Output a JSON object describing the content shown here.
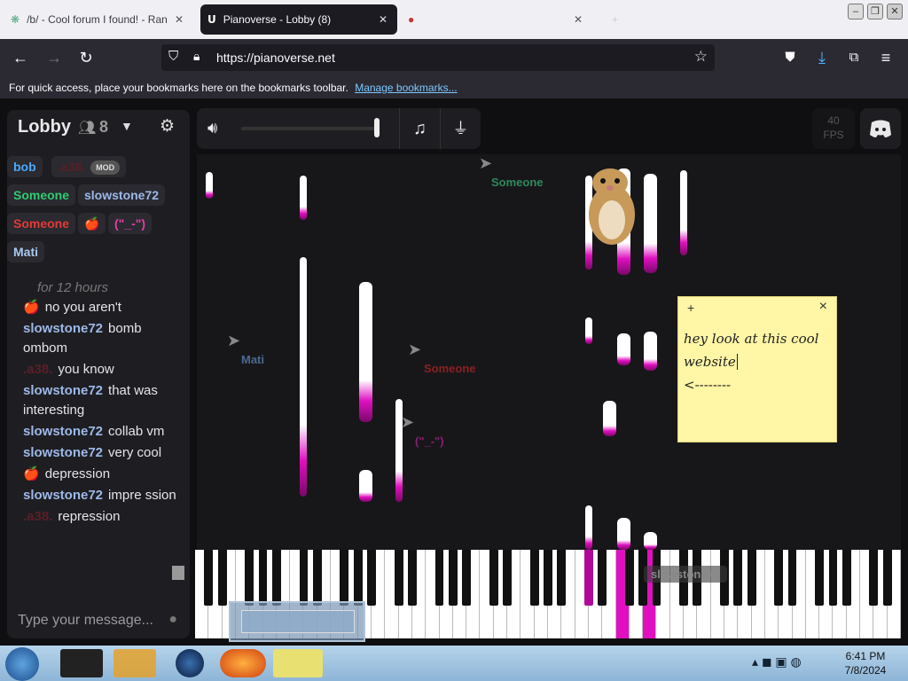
{
  "tabs": [
    {
      "title": "/b/ - Cool forum I found! - Ran",
      "close": "✕"
    },
    {
      "title": "Pianoverse - Lobby (8)",
      "close": "✕"
    },
    {
      "title": "",
      "close": "✕"
    }
  ],
  "new_tab": "+",
  "url": "https://pianoverse.net",
  "bookmarks_bar": {
    "text": "For quick access, place your bookmarks here on the bookmarks toolbar.",
    "link": "Manage bookmarks..."
  },
  "lobby": {
    "title": "Lobby",
    "count": "8"
  },
  "users": [
    {
      "name": "bob",
      "color": "#4aa8ff"
    },
    {
      "name": ".a38.",
      "color": "#5a1e28",
      "badge": "MOD"
    },
    {
      "name": "Someone",
      "color": "#2ecc71"
    },
    {
      "name": "slowstone72",
      "color": "#9db8e8"
    },
    {
      "name": "Someone",
      "color": "#e53935"
    },
    {
      "name": "🍎",
      "color": "#e53935"
    },
    {
      "name": "(\"_-\")",
      "color": "#e040a0"
    },
    {
      "name": "Mati",
      "color": "#a9c8f0"
    }
  ],
  "chat": {
    "partial": "for 12 hours",
    "messages": [
      {
        "name": "🍎",
        "text": "no you aren't",
        "cls": "nm"
      },
      {
        "name": "slowstone72",
        "text": "bomb ombom",
        "cls": "nm"
      },
      {
        "name": ".a38.",
        "text": "you know",
        "cls": "nm red"
      },
      {
        "name": "slowstone72",
        "text": "that was interesting",
        "cls": "nm"
      },
      {
        "name": "slowstone72",
        "text": "collab vm",
        "cls": "nm"
      },
      {
        "name": "slowstone72",
        "text": "very cool",
        "cls": "nm"
      },
      {
        "name": "🍎",
        "text": "depression",
        "cls": "nm"
      },
      {
        "name": "slowstone72",
        "text": "impre ssion",
        "cls": "nm"
      },
      {
        "name": ".a38.",
        "text": "repression",
        "cls": "nm red"
      }
    ],
    "placeholder": "Type your message..."
  },
  "fps": {
    "value": "40",
    "label": "FPS"
  },
  "cursors": [
    {
      "label": "Someone",
      "color": "#2e8a5a"
    },
    {
      "label": "Mati",
      "color": "#4a6a90"
    },
    {
      "label": "Someone",
      "color": "#8a2020"
    },
    {
      "label": "(\"_-\")",
      "color": "#8a2070"
    },
    {
      "label": "slowstone72",
      "color": "#888"
    }
  ],
  "sticky": {
    "plus": "+",
    "close": "×",
    "lines": [
      "hey look at this cool",
      "website",
      "<--------"
    ]
  },
  "taskbar": {
    "time": "6:41 PM",
    "date": "7/8/2024"
  }
}
